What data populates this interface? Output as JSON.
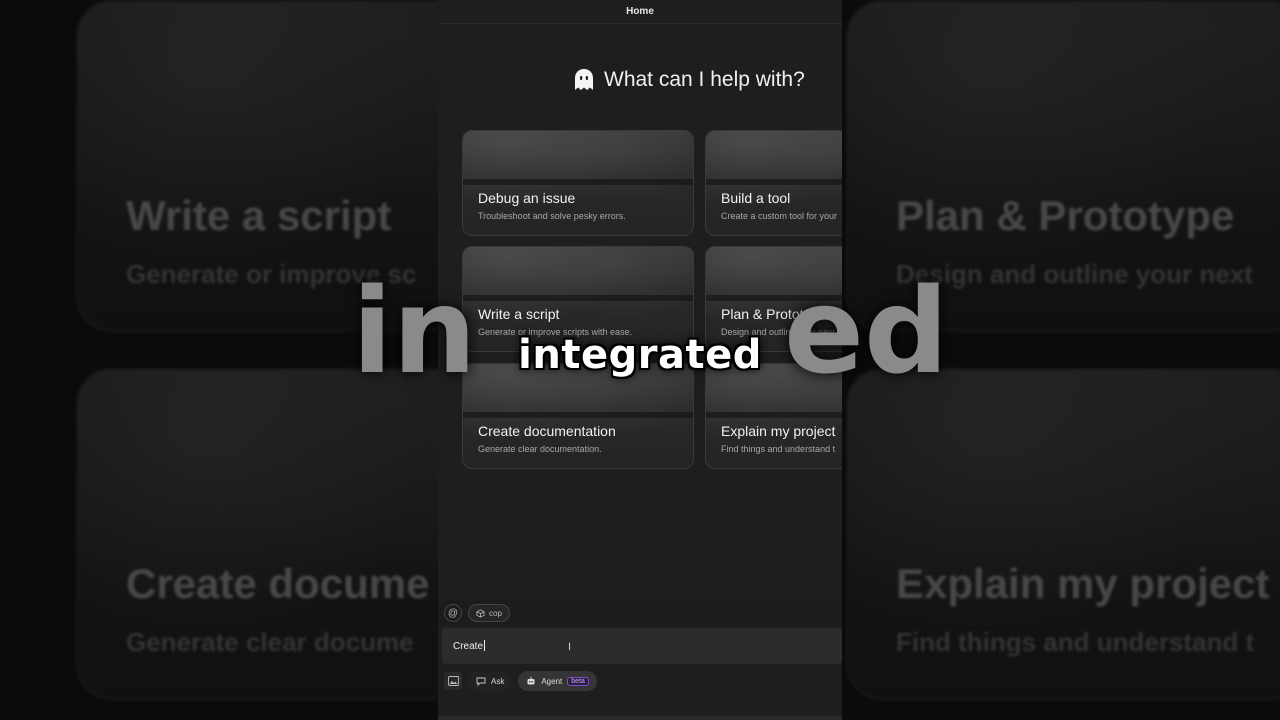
{
  "panel": {
    "title": "Home",
    "heading": "What can I help with?"
  },
  "cards": [
    {
      "title": "Debug an issue",
      "subtitle": "Troubleshoot and solve pesky errors."
    },
    {
      "title": "Build a tool",
      "subtitle": "Create a custom tool for your"
    },
    {
      "title": "Write a script",
      "subtitle": "Generate or improve scripts with ease."
    },
    {
      "title": "Plan & Prototype",
      "subtitle": "Design and outline your next"
    },
    {
      "title": "Create documentation",
      "subtitle": "Generate clear documentation."
    },
    {
      "title": "Explain my project",
      "subtitle": "Find things and understand t"
    }
  ],
  "background_cards": [
    {
      "title": "Write a script",
      "subtitle": "Generate or improve sc"
    },
    {
      "title": "Plan & Prototype",
      "subtitle": "Design and outline your next"
    },
    {
      "title": "Create docume",
      "subtitle": "Generate clear docume"
    },
    {
      "title": "Explain my project",
      "subtitle": "Find things and understand t"
    }
  ],
  "context": {
    "at_symbol": "@",
    "chip_label": "cop"
  },
  "input": {
    "value": "Create"
  },
  "modes": {
    "ask_label": "Ask",
    "agent_label": "Agent",
    "agent_badge": "beta"
  },
  "caption": {
    "text": "integrated",
    "big_left": "in",
    "big_right": "ed"
  }
}
